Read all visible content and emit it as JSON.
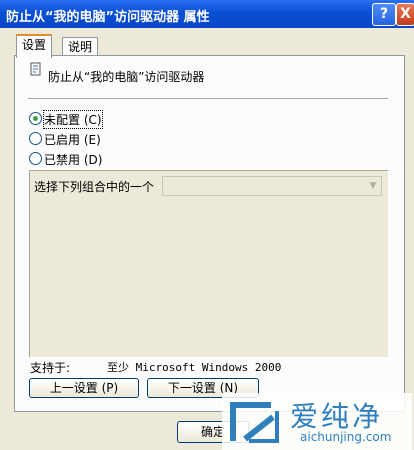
{
  "window": {
    "title": "防止从“我的电脑”访问驱动器 属性",
    "help_glyph": "?",
    "close_glyph": "X"
  },
  "tabs": [
    {
      "label": "设置"
    },
    {
      "label": "说明"
    }
  ],
  "policy": {
    "title": "防止从“我的电脑”访问驱动器",
    "icon": "policy-document-icon"
  },
  "state": {
    "selected": "未配置",
    "options": [
      {
        "label": "未配置 (C)"
      },
      {
        "label": "已启用 (E)"
      },
      {
        "label": "已禁用 (D)"
      }
    ]
  },
  "options_panel": {
    "combo_label": "选择下列组合中的一个",
    "combo_value": ""
  },
  "support": {
    "label": "支持于:",
    "value": "至少 Microsoft Windows 2000"
  },
  "buttons": {
    "prev": "上一设置 (P)",
    "next": "下一设置 (N)",
    "ok": "确定"
  },
  "watermark": {
    "name": "爱纯净",
    "url": "aichunjing.com"
  },
  "colors": {
    "title_bar": "#0a4fd6",
    "tab_accent": "#e68b2c",
    "watermark": "#2f7fbf"
  }
}
